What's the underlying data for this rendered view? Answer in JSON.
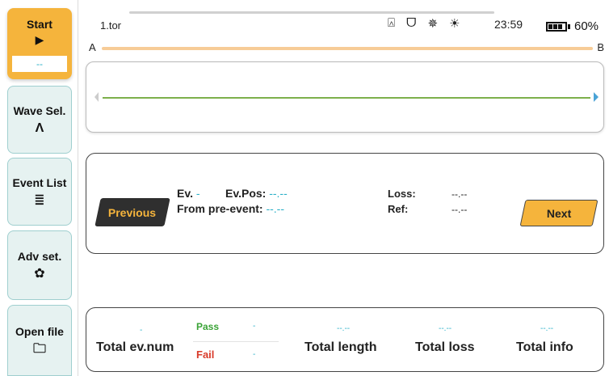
{
  "sidebar": {
    "start": {
      "label": "Start",
      "glyph": "▶",
      "value": "--"
    },
    "items": [
      {
        "label": "Wave Sel.",
        "glyph": "Λ",
        "icon": "wave-up-icon"
      },
      {
        "label": "Event List",
        "glyph": "≣",
        "icon": "list-icon"
      },
      {
        "label": "Adv set.",
        "glyph": "✿",
        "icon": "gear-icon"
      },
      {
        "label": "Open file",
        "glyph": "🗀",
        "icon": "folder-icon"
      }
    ]
  },
  "topbar": {
    "filename": "1.tor",
    "icons": [
      "usb-icon",
      "plug-icon",
      "sun-icon",
      "brightness-icon"
    ],
    "icon_glyphs": [
      "⍓",
      "ᗜ",
      "✵",
      "☀"
    ],
    "time": "23:59",
    "battery_percent": "60%",
    "battery_level": 0.6
  },
  "ab": {
    "a": "A",
    "b": "B"
  },
  "event": {
    "previous_label": "Previous",
    "next_label": "Next",
    "ev_label": "Ev.",
    "ev_value": "-",
    "evpos_label": "Ev.Pos:",
    "evpos_value": "--.--",
    "from_label": "From pre-event:",
    "from_value": "--.--",
    "loss_label": "Loss:",
    "loss_value": "--.--",
    "ref_label": "Ref:",
    "ref_value": "--.--"
  },
  "summary": {
    "total_ev_num_label": "Total ev.num",
    "total_ev_num_value": "-",
    "pass_label": "Pass",
    "pass_value": "-",
    "fail_label": "Fail",
    "fail_value": "-",
    "total_length_label": "Total length",
    "total_length_value": "--.--",
    "total_loss_label": "Total loss",
    "total_loss_value": "--.--",
    "total_info_label": "Total info",
    "total_info_value": "--.--"
  },
  "colors": {
    "accent": "#f5b43c",
    "value_text": "#2ab0c8",
    "trace": "#7db04b",
    "pass": "#3aa336",
    "fail": "#d93b2a"
  }
}
